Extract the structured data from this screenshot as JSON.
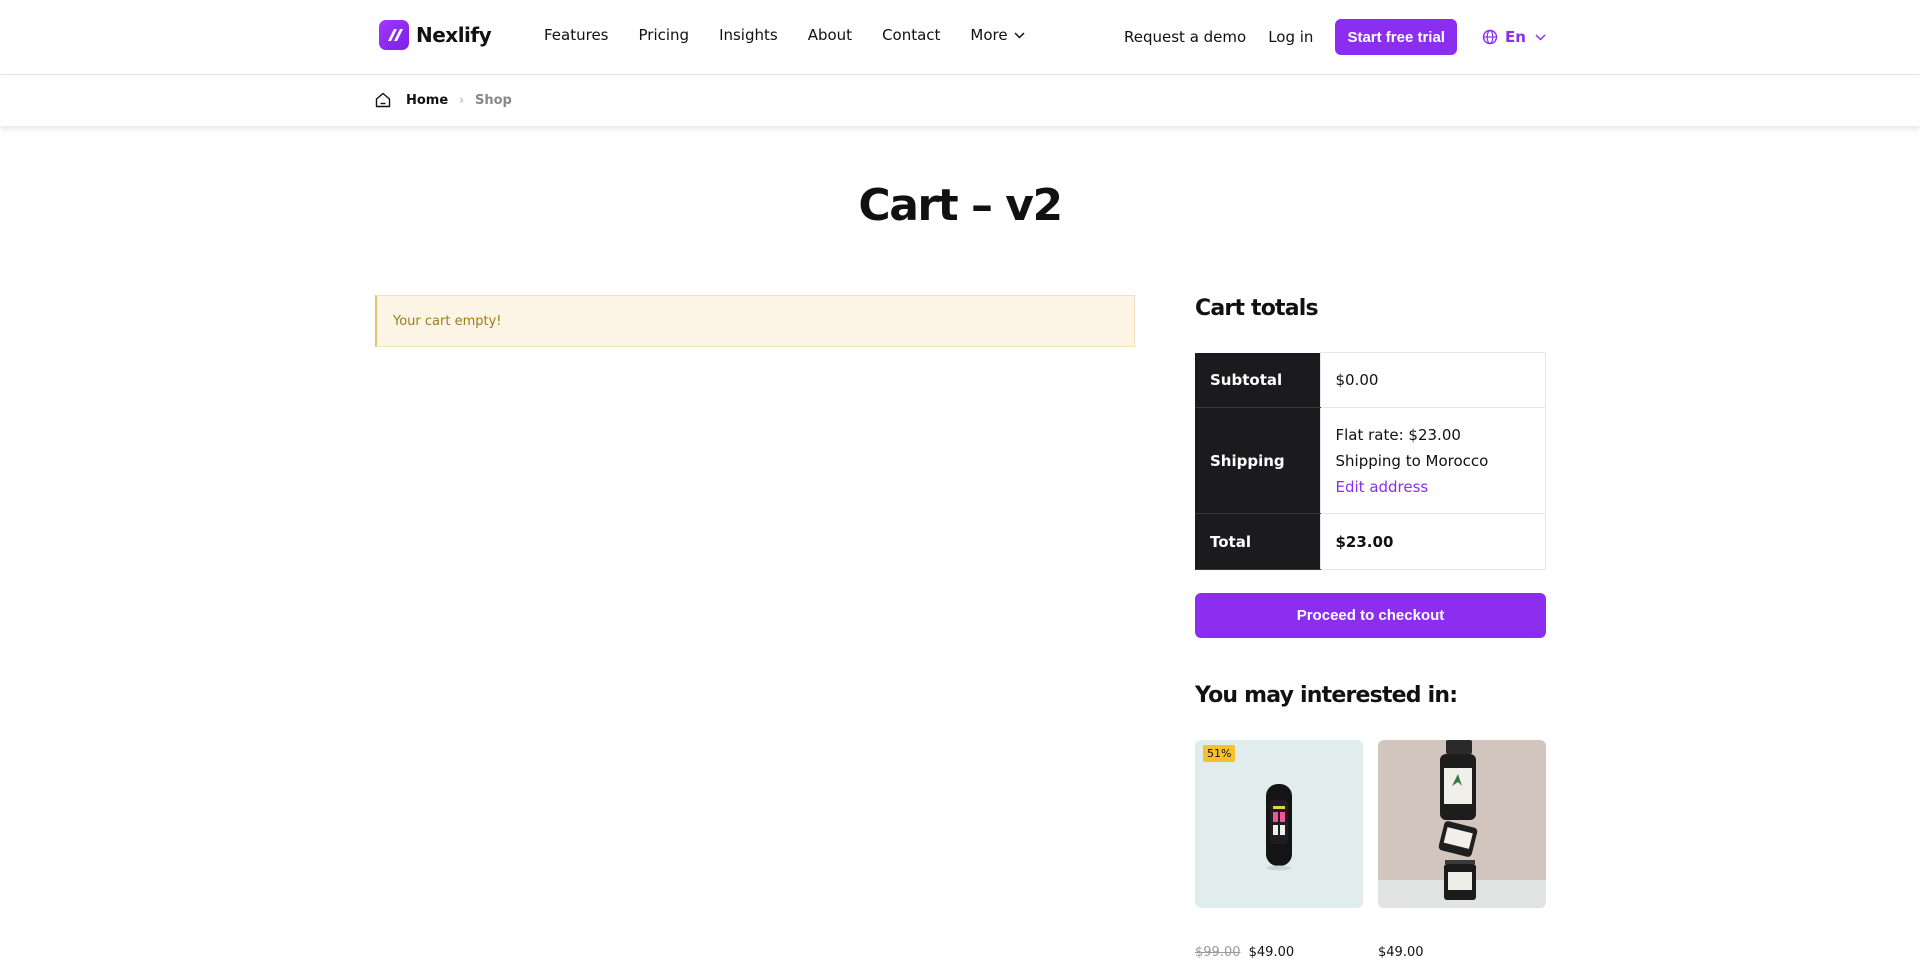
{
  "brand": {
    "name": "Nexlify",
    "accent": "#8b2ef0"
  },
  "nav": {
    "items": [
      "Features",
      "Pricing",
      "Insights",
      "About",
      "Contact"
    ],
    "more_label": "More"
  },
  "header_actions": {
    "demo_label": "Request a demo",
    "login_label": "Log in",
    "trial_label": "Start free trial",
    "lang_label": "En"
  },
  "breadcrumb": {
    "home": "Home",
    "current": "Shop"
  },
  "page": {
    "title": "Cart – v2"
  },
  "notice": {
    "text": "Your cart empty!"
  },
  "totals": {
    "heading": "Cart totals",
    "subtotal_label": "Subtotal",
    "subtotal_value": "$0.00",
    "shipping_label": "Shipping",
    "shipping_rate": "Flat rate: $23.00",
    "shipping_to": "Shipping to Morocco",
    "edit_address": "Edit address",
    "total_label": "Total",
    "total_value": "$23.00",
    "checkout_label": "Proceed to checkout"
  },
  "recommend": {
    "heading": "You may interested in:",
    "products": [
      {
        "badge": "51%",
        "old_price": "$99.00",
        "price": "$49.00",
        "image": "fitness-band-photo"
      },
      {
        "price": "$49.00",
        "image": "stacked-bottles-photo"
      }
    ]
  }
}
